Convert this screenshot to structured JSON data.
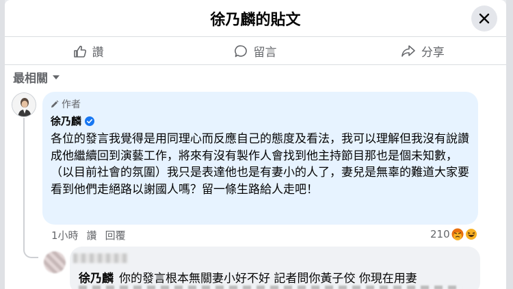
{
  "header": {
    "title": "徐乃麟的貼文",
    "close_icon": "close-icon"
  },
  "actions": [
    {
      "label": "讚",
      "icon": "like-icon"
    },
    {
      "label": "留言",
      "icon": "comment-icon"
    },
    {
      "label": "分享",
      "icon": "share-icon"
    }
  ],
  "sort": {
    "label": "最相關",
    "icon": "caret-down-icon"
  },
  "comment": {
    "author_tag": "作者",
    "author_name": "徐乃麟",
    "verified": true,
    "text": "各位的發言我覺得是用同理心而反應自己的態度及看法，我可以理解但我沒有說讚成他繼續回到演藝工作，將來有沒有製作人會找到他主持節目那也是個未知數，（以目前社會的氛圍）我只是表達他也是有妻小的人了，妻兒是無辜的難道大家要看到他們走絕路以謝國人嗎？留一條生路給人走吧！",
    "time": "1小時",
    "like_label": "讚",
    "reply_label": "回覆",
    "reaction_count": "210",
    "colors": {
      "bubble": "#e7f3ff",
      "verified": "#1877f2"
    }
  },
  "reply": {
    "mention": "徐乃麟",
    "text": "你的發言根本無關妻小好不好 記者問你黃子佼 你現在用妻"
  }
}
